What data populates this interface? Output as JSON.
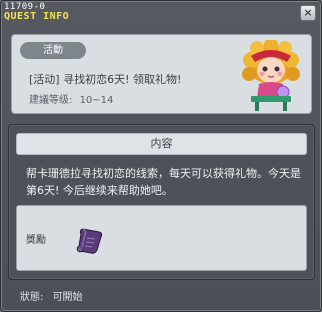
{
  "window": {
    "quest_id": "11709-0",
    "title": "QUEST INFO",
    "close_label": "×"
  },
  "info": {
    "badge": "活動",
    "quest_name": "[活动] 寻找初恋6天! 领取礼物!",
    "level_label": "建議等级:",
    "level_value": "10~14"
  },
  "content": {
    "header": "内容",
    "description": "帮卡珊德拉寻找初恋的线索，每天可以获得礼物。今天是第6天! 今后继续来帮助她吧。",
    "reward_label": "獎勵"
  },
  "status": {
    "label": "狀態:",
    "value": "可開始"
  },
  "colors": {
    "title": "#f2e24e",
    "window_bg": "#565a60",
    "panel_bg": "#d9dee2",
    "badge_bg": "#7e858c"
  },
  "icons": {
    "npc": "npc-portrait-icon",
    "reward": "scroll-item-icon"
  }
}
